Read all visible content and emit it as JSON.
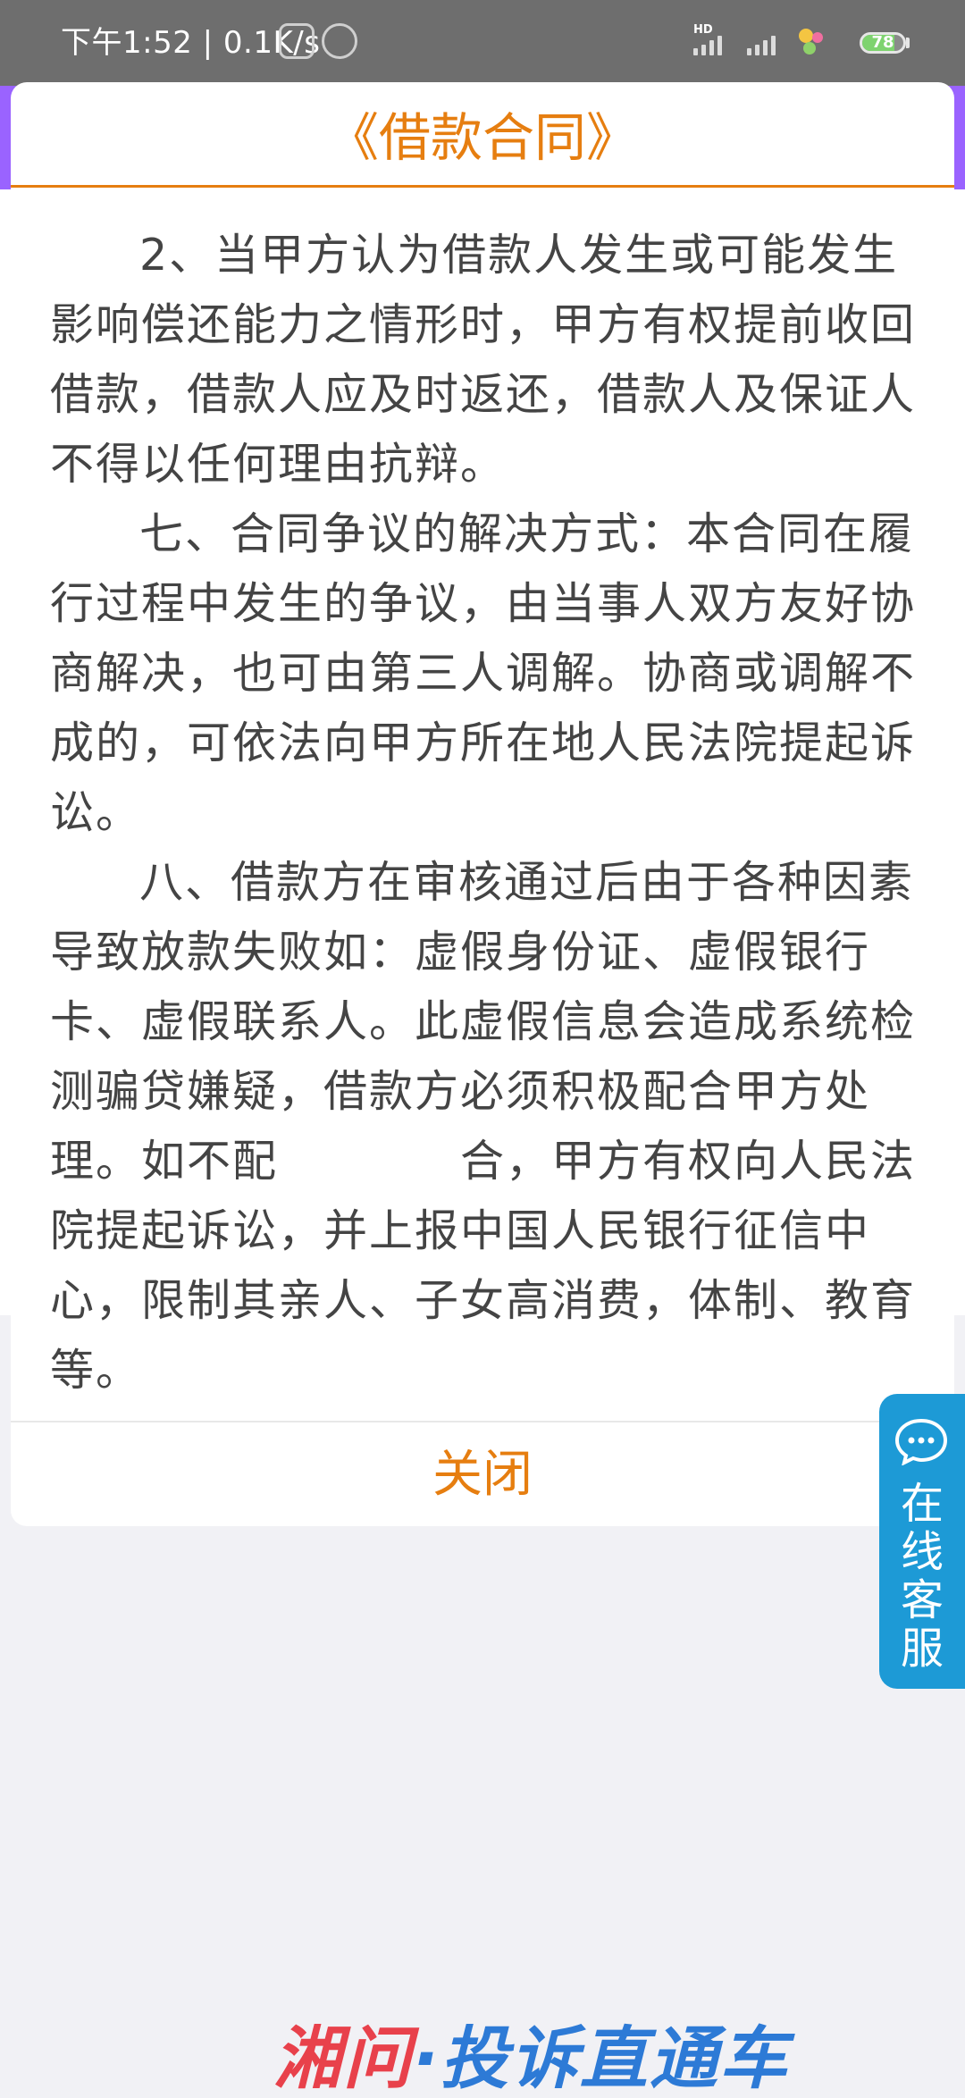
{
  "status_bar": {
    "time": "下午1:52 | 0.1K/s",
    "network_label": "HD",
    "battery_level": "78",
    "battery_fraction": 0.78,
    "icons": [
      "phone-app-icon",
      "alarm-icon",
      "signal-icon",
      "signal-icon",
      "notification-icon",
      "battery-icon"
    ]
  },
  "modal": {
    "title": "《借款合同》",
    "clauses": [
      "2、当甲方认为借款人发生或可能发生影响偿还能力之情形时，甲方有权提前收回借款，借款人应及时返还，借款人及保证人不得以任何理由抗辩。",
      "七、合同争议的解决方式：本合同在履行过程中发生的争议，由当事人双方友好协商解决，也可由第三人调解。协商或调解不成的，可依法向甲方所在地人民法院提起诉讼。",
      "八、借款方在审核通过后由于各种因素导致放款失败如：虚假身份证、虚假银行卡、虚假联系人。此虚假信息会造成系统检测骗贷嫌疑，借款方必须积极配合甲方处理。如不配　　　　合，甲方有权向人民法院提起诉讼，并上报中国人民银行征信中心，限制其亲人、子女高消费，体制、教育等。"
    ],
    "close_label": "关闭"
  },
  "service": {
    "line1": "在",
    "line2": "线",
    "line3": "客",
    "line4": "服",
    "icon": "chat-bubble-icon"
  },
  "watermark": {
    "part1": "湘问",
    "part2": "·投诉直通车"
  },
  "colors": {
    "accent": "#e67e10",
    "header": "#9a63ff",
    "service": "#1d9ad6",
    "text": "#444444"
  }
}
